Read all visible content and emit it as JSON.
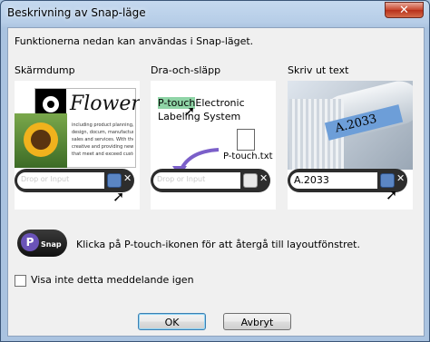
{
  "window": {
    "title": "Beskrivning av Snap-läge",
    "close_glyph": "✕"
  },
  "intro": "Funktionerna nedan kan användas i Snap-läget.",
  "columns": [
    {
      "label": "Skärmdump"
    },
    {
      "label": "Dra-och-släpp"
    },
    {
      "label": "Skriv ut text"
    }
  ],
  "screenshot_panel": {
    "doc_title": "Flower",
    "doc_lines": [
      "including product planning, de",
      "design, docum, manufactur.ing",
      "sales and services. With the ac",
      "creative and providing new",
      "that meet and exceed custome"
    ],
    "drop_placeholder": "Drop or Input"
  },
  "dragdrop_panel": {
    "highlight": "P-touch",
    "line1_rest": "Electronic",
    "line2": "Labeling System",
    "file_name": "P-touch.txt",
    "drop_placeholder": "Drop or Input"
  },
  "printtext_panel": {
    "label_text": "A.2033",
    "input_value": "A.2033"
  },
  "hint": "Klicka på P-touch-ikonen för att återgå till layoutfönstret.",
  "snap_icon_label": "Snap",
  "checkbox": {
    "label": "Visa inte detta meddelande igen",
    "checked": false
  },
  "buttons": {
    "ok": "OK",
    "cancel": "Avbryt"
  },
  "colors": {
    "accent": "#3c7fb1",
    "highlight": "#8fd4a6",
    "tape": "#6d9ed8",
    "drop_bar": "#2d2d2d"
  }
}
